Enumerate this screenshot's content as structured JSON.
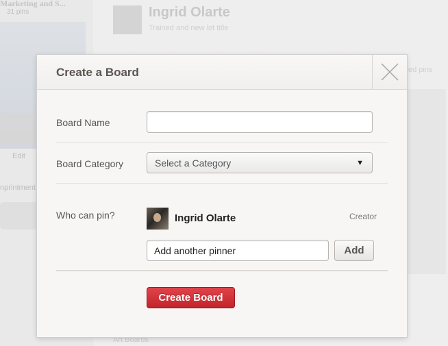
{
  "background": {
    "left_title": "Marketing and S...",
    "left_subtitle": "31 pins",
    "left_edit": "Edit",
    "left_bottom": "nprintment",
    "profile_name": "Ingrid Olarte",
    "profile_tagline": "Trained and new lot title",
    "right_text": "ted pins",
    "bottom_text": "Art Boards"
  },
  "modal": {
    "title": "Create a Board",
    "close_icon": "close-icon",
    "fields": {
      "board_name_label": "Board Name",
      "board_name_value": "",
      "board_category_label": "Board Category",
      "board_category_selected": "Select a Category",
      "who_can_pin_label": "Who can pin?"
    },
    "pinners": [
      {
        "name": "Ingrid Olarte",
        "role": "Creator"
      }
    ],
    "add_pinner": {
      "value": "Add another pinner",
      "button": "Add"
    },
    "create_button": "Create Board"
  },
  "colors": {
    "accent_red": "#c9282f",
    "modal_bg": "#f7f6f5",
    "title_color": "#5a5450"
  }
}
